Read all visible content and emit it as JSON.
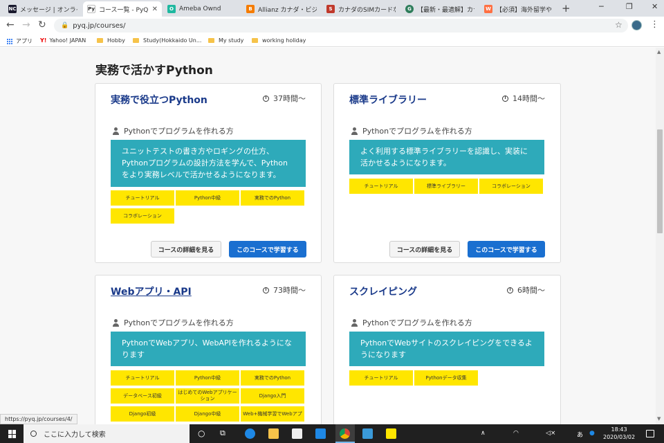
{
  "browser": {
    "tabs": [
      {
        "title": "メッセージ | オンライン",
        "favicon": "NC",
        "color": "#1a1a2e"
      },
      {
        "title": "コース一覧 - PyQ",
        "favicon": "Py",
        "color": "#ffffff",
        "active": true
      },
      {
        "title": "Ameba Ownd",
        "favicon": "O",
        "color": "#1fb8a0"
      },
      {
        "title": "Allianz カナダ・ビジタ",
        "favicon": "B",
        "color": "#f57c00"
      },
      {
        "title": "カナダのSIMカードなら",
        "favicon": "S",
        "color": "#c0392b"
      },
      {
        "title": "【最新・最適解】カナ",
        "favicon": "G",
        "color": "#2e7d5b"
      },
      {
        "title": "【必須】海外留学や",
        "favicon": "W",
        "color": "#ff7043"
      }
    ],
    "new_tab": "+",
    "url": "pyq.jp/courses/",
    "bookmarks": [
      "アプリ",
      "Yahoo! JAPAN",
      "Hobby",
      "Study(Hokkaido Un...",
      "My study",
      "working holiday"
    ],
    "status_url": "https://pyq.jp/courses/4/"
  },
  "page": {
    "section_title": "実務で活かすPython",
    "cards": [
      {
        "title": "実務で役立つPython",
        "time": "37時間〜",
        "target": "Pythonでプログラムを作れる方",
        "desc": "ユニットテストの書き方やロギングの仕方、Pythonプログラムの設計方法を学んで、Pythonをより実務レベルで活かせるようになります。",
        "tags": [
          "チュートリアル",
          "Python中級",
          "実務でのPython",
          "コラボレーション"
        ],
        "detail_button": "コースの詳細を見る",
        "learn_button": "このコースで学習する"
      },
      {
        "title": "標準ライブラリー",
        "time": "14時間〜",
        "target": "Pythonでプログラムを作れる方",
        "desc": "よく利用する標準ライブラリーを認識し、実装に活かせるようになります。",
        "tags": [
          "チュートリアル",
          "標準ライブラリー",
          "コラボレーション"
        ],
        "detail_button": "コースの詳細を見る",
        "learn_button": "このコースで学習する"
      },
      {
        "title": "Webアプリ・API",
        "time": "73時間〜",
        "target": "Pythonでプログラムを作れる方",
        "desc": "PythonでWebアプリ、WebAPIを作れるようになります",
        "tags": [
          "チュートリアル",
          "Python中級",
          "実務でのPython",
          "データベース初級",
          "はじめてのWebアプリケーション",
          "Django入門",
          "Django初級",
          "Django中級",
          "Web+機械学習でWebアプ"
        ]
      },
      {
        "title": "スクレイピング",
        "time": "6時間〜",
        "target": "Pythonでプログラムを作れる方",
        "desc": "PythonでWebサイトのスクレイピングをできるようになります",
        "tags": [
          "チュートリアル",
          "Pythonデータ収集"
        ]
      }
    ]
  },
  "taskbar": {
    "search_placeholder": "ここに入力して検索",
    "ime": "あ",
    "time": "18:43",
    "date": "2020/03/02"
  }
}
